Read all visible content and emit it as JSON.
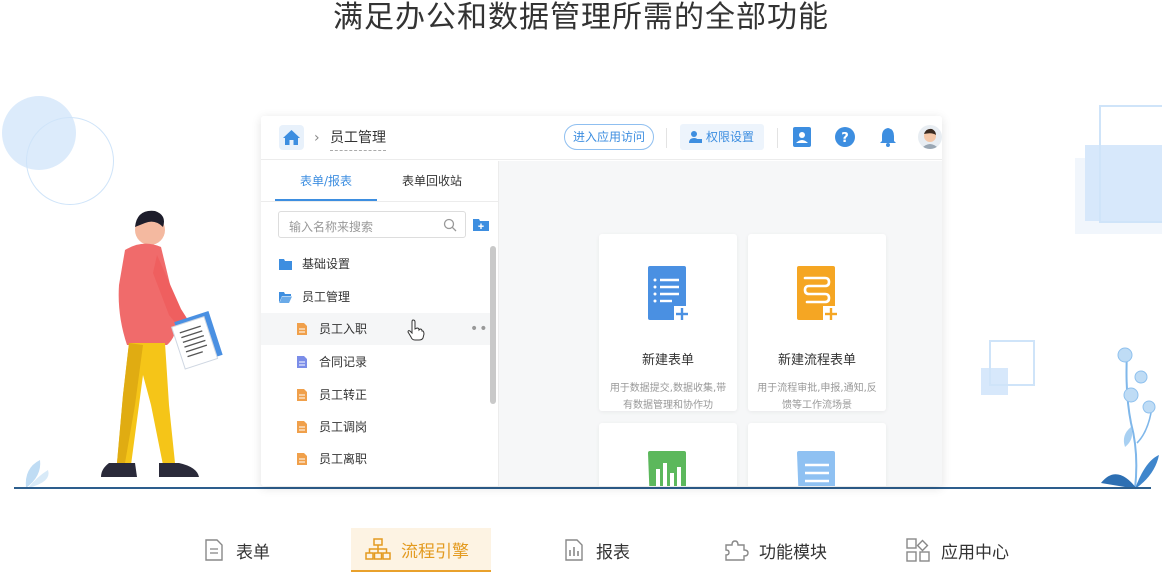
{
  "headline": "满足办公和数据管理所需的全部功能",
  "app": {
    "breadcrumb": "员工管理",
    "enter_app_button": "进入应用访问",
    "permission_button": "权限设置",
    "tabs": [
      {
        "label": "表单/报表",
        "active": true
      },
      {
        "label": "表单回收站",
        "active": false
      }
    ],
    "search_placeholder": "输入名称来搜索",
    "tree": [
      {
        "label": "基础设置",
        "type": "folder",
        "level": 0
      },
      {
        "label": "员工管理",
        "type": "folder-open",
        "level": 0
      },
      {
        "label": "员工入职",
        "type": "form",
        "level": 1,
        "selected": true
      },
      {
        "label": "合同记录",
        "type": "form",
        "level": 1
      },
      {
        "label": "员工转正",
        "type": "form",
        "level": 1
      },
      {
        "label": "员工调岗",
        "type": "form",
        "level": 1
      },
      {
        "label": "员工离职",
        "type": "form",
        "level": 1
      }
    ],
    "more_menu": "•••",
    "cards": [
      {
        "title": "新建表单",
        "desc": "用于数据提交,数据收集,带有数据管理和协作功",
        "icon": "form-icon",
        "color": "#4a90e2"
      },
      {
        "title": "新建流程表单",
        "desc": "用于流程审批,申报,通知,反馈等工作流场景",
        "icon": "flow-form-icon",
        "color": "#f5a623"
      },
      {
        "title": "",
        "desc": "",
        "icon": "report-icon",
        "color": "#5cb85c"
      },
      {
        "title": "",
        "desc": "",
        "icon": "list-icon",
        "color": "#8fc1f2"
      }
    ]
  },
  "bottom_nav": [
    {
      "label": "表单",
      "icon": "form-doc-icon",
      "active": false
    },
    {
      "label": "流程引擎",
      "icon": "hierarchy-icon",
      "active": true
    },
    {
      "label": "报表",
      "icon": "report-chart-icon",
      "active": false
    },
    {
      "label": "功能模块",
      "icon": "puzzle-icon",
      "active": false
    },
    {
      "label": "应用中心",
      "icon": "grid-apps-icon",
      "active": false
    }
  ],
  "colors": {
    "primary": "#3d8ee0",
    "accent": "#e9a12c",
    "folder": "#3d8ee0",
    "form_file": "#f0a04b",
    "contract_file": "#7b8de8"
  }
}
